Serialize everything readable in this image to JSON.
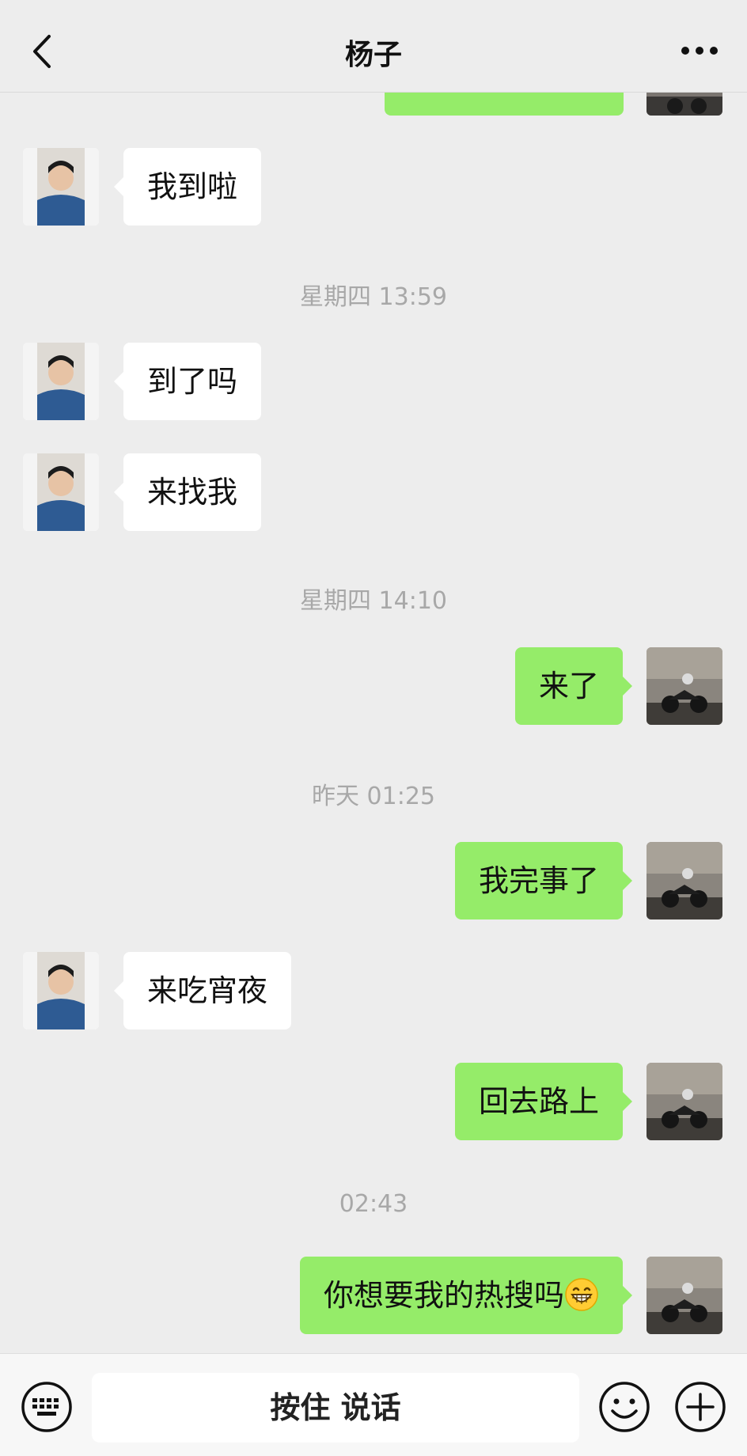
{
  "header": {
    "title": "杨子"
  },
  "messages": [
    {
      "type": "timestamp",
      "text": "星期四 13:59"
    },
    {
      "side": "left",
      "text": "到了吗"
    },
    {
      "side": "left",
      "text": "来找我"
    },
    {
      "type": "timestamp",
      "text": "星期四 14:10"
    },
    {
      "side": "right",
      "text": "来了"
    },
    {
      "type": "timestamp",
      "text": "昨天 01:25"
    },
    {
      "side": "right",
      "text": "我完事了"
    },
    {
      "side": "left",
      "text": "来吃宵夜"
    },
    {
      "side": "right",
      "text": "回去路上"
    },
    {
      "type": "timestamp",
      "text": "02:43"
    },
    {
      "side": "right",
      "text": "你想要我的热搜吗"
    }
  ],
  "top_message": {
    "side": "left",
    "text": "我到啦"
  },
  "input_bar": {
    "hold_to_talk_label": "按住 说话"
  },
  "colors": {
    "background": "#ededed",
    "green_bubble": "#95ec69",
    "white_bubble": "#ffffff",
    "timestamp_text": "#a8a8a8"
  },
  "icons": [
    "back-arrow-icon",
    "more-dots-icon",
    "keyboard-icon",
    "smiley-icon",
    "plus-icon",
    "grinning-emoji"
  ]
}
